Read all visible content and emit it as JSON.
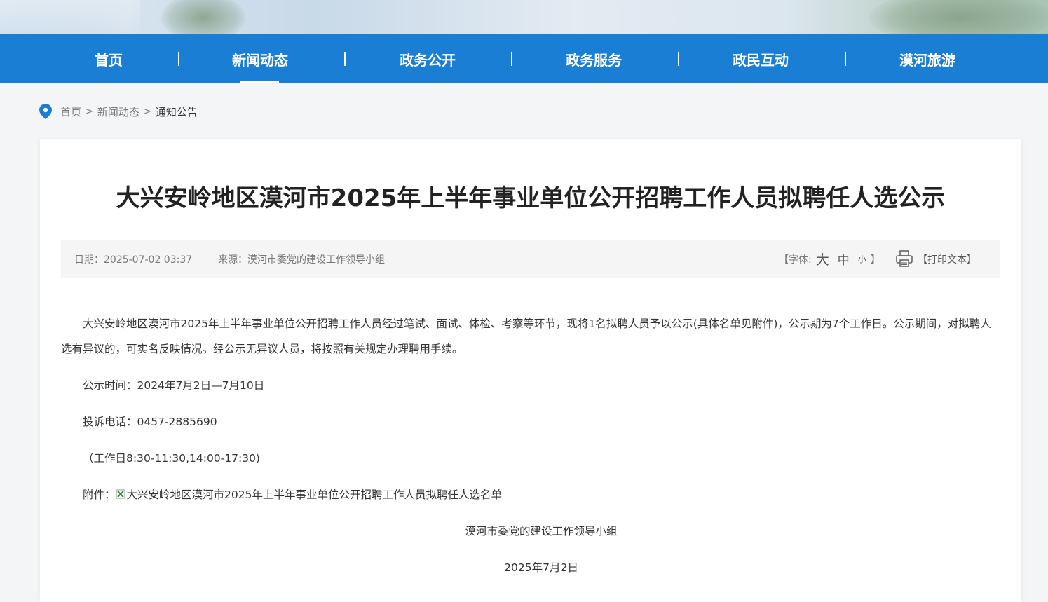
{
  "nav": {
    "items": [
      {
        "label": "首页"
      },
      {
        "label": "新闻动态"
      },
      {
        "label": "政务公开"
      },
      {
        "label": "政务服务"
      },
      {
        "label": "政民互动"
      },
      {
        "label": "漠河旅游"
      }
    ],
    "separator": "|"
  },
  "breadcrumb": {
    "home": "首页",
    "section": "新闻动态",
    "current": "通知公告",
    "separator": ">"
  },
  "article": {
    "title": "大兴安岭地区漠河市2025年上半年事业单位公开招聘工作人员拟聘任人选公示",
    "date": "日期：2025-07-02 03:37",
    "source": "来源：漠河市委党的建设工作领导小组",
    "font_label_open": "【字体:",
    "font_big": "大",
    "font_mid": "中",
    "font_small": "小",
    "font_label_close": "】",
    "print_label": "【打印文本】",
    "para1": "大兴安岭地区漠河市2025年上半年事业单位公开招聘工作人员经过笔试、面试、体检、考察等环节，现将1名拟聘人员予以公示(具体名单见附件)，公示期为7个工作日。公示期间，对拟聘人选有异议的，可实名反映情况。经公示无异议人员，将按照有关规定办理聘用手续。",
    "period": "公示时间：2024年7月2日—7月10日",
    "phone": "投诉电话：0457-2885690",
    "hours": "（工作日8:30-11:30,14:00-17:30)",
    "attachment_label": "附件：",
    "attachment_name": "大兴安岭地区漠河市2025年上半年事业单位公开招聘工作人员拟聘任人选名单",
    "signature": "漠河市委党的建设工作领导小组",
    "sign_date": "2025年7月2日"
  },
  "colors": {
    "nav_bg": "#1a7fd4",
    "pin": "#1a7fd4"
  }
}
